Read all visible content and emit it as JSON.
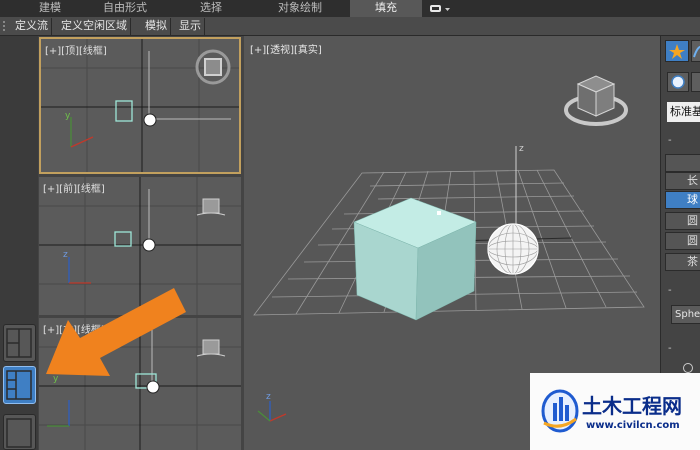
{
  "ribbon": {
    "tabs": [
      {
        "label": "建模",
        "active": false
      },
      {
        "label": "自由形式",
        "active": false
      },
      {
        "label": "选择",
        "active": false
      },
      {
        "label": "对象绘制",
        "active": false
      },
      {
        "label": "填充",
        "active": true
      }
    ]
  },
  "toolbar": {
    "buttons": [
      "定义流",
      "定义空闲区域",
      "模拟",
      "显示"
    ]
  },
  "viewports": {
    "top": {
      "label": "[+][顶][线框]"
    },
    "front": {
      "label": "[+][前][线框]"
    },
    "left": {
      "label": "[+][左][线框]"
    },
    "perspective": {
      "label": "[+][透视][真实]"
    }
  },
  "axes": {
    "x": "x",
    "y": "y",
    "z": "z"
  },
  "command_panel": {
    "search_value": "标准基",
    "rollout_minus": "-",
    "object_types": [
      "长",
      "球",
      "圆",
      "圆",
      "茶"
    ],
    "selected_index": 1,
    "name_value": "Sphe"
  },
  "watermark": {
    "title": "土木工程网",
    "url": "www.civilcn.com"
  },
  "colors": {
    "active_viewport_border": "#c2a05e",
    "highlight_blue": "#3f7fc4",
    "box": "#a9d6cf",
    "annotation_arrow": "#f0821e"
  }
}
